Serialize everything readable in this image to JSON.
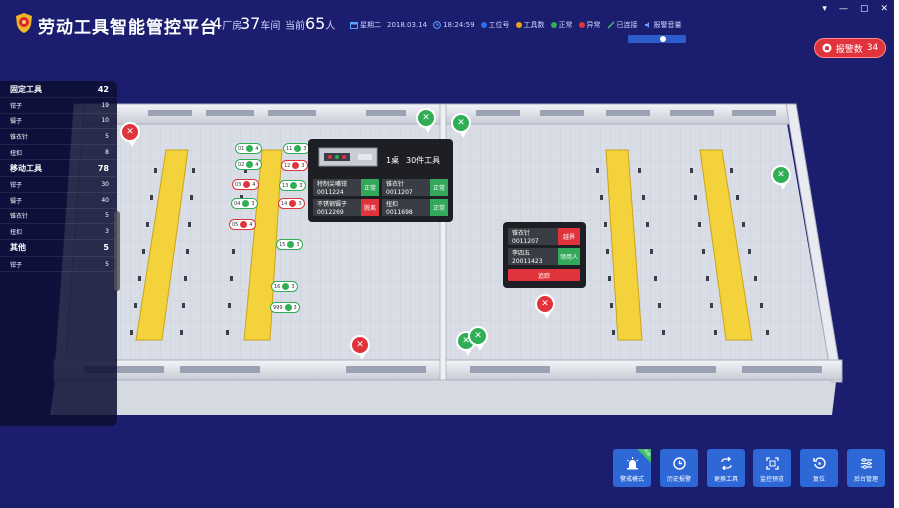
{
  "header": {
    "title": "劳动工具智能管控平台",
    "factory_num": "4",
    "factory_unit": "厂房",
    "workshop_num": "37",
    "workshop_unit": "车间",
    "current_prefix": "当前",
    "current_num": "65",
    "current_unit": "人",
    "weekday": "星期二",
    "date": "2018.03.14",
    "time": "18:24:59",
    "legend": [
      {
        "label": "工位号",
        "color": "#2f6cf0"
      },
      {
        "label": "工具数",
        "color": "#f0a21e"
      },
      {
        "label": "正常",
        "color": "#2fae55"
      },
      {
        "label": "异常",
        "color": "#e0333b"
      }
    ],
    "connected": "已连接",
    "volume_label": "报警音量",
    "volume_level": 0.62,
    "alarm_label": "报警数",
    "alarm_count": "34"
  },
  "left_panel": {
    "groups": [
      {
        "name": "固定工具",
        "count": "42",
        "items": [
          {
            "name": "钳子",
            "count": "19"
          },
          {
            "name": "镊子",
            "count": "10"
          },
          {
            "name": "锥衣针",
            "count": "5"
          },
          {
            "name": "扭扣",
            "count": "8"
          }
        ]
      },
      {
        "name": "移动工具",
        "count": "78",
        "items": [
          {
            "name": "钳子",
            "count": "30"
          },
          {
            "name": "镊子",
            "count": "40"
          },
          {
            "name": "锥衣针",
            "count": "5"
          },
          {
            "name": "扭扣",
            "count": "3"
          }
        ]
      },
      {
        "name": "其他",
        "count": "5",
        "items": [
          {
            "name": "钳子",
            "count": "5"
          }
        ]
      }
    ]
  },
  "popup_station": {
    "desk": "1桌",
    "tools": "30件工具",
    "rows": [
      {
        "name": "特制尖嘴钳",
        "code": "0011224",
        "status": "正常",
        "state": "ok"
      },
      {
        "name": "锥衣针",
        "code": "0011207",
        "status": "正常",
        "state": "ok"
      },
      {
        "name": "不锈钢镊子",
        "code": "0012269",
        "status": "脱离",
        "state": "bad"
      },
      {
        "name": "扭扣",
        "code": "0011698",
        "status": "正常",
        "state": "ok"
      }
    ]
  },
  "popup_alert": {
    "rows": [
      {
        "name": "锥衣针",
        "code": "0011207",
        "status": "越界",
        "state": "bad"
      },
      {
        "name": "李四五",
        "code": "20011423",
        "status": "领用人",
        "state": "ok"
      }
    ],
    "action": "追踪"
  },
  "badges": [
    {
      "label": "01",
      "n": "4",
      "state": "ok"
    },
    {
      "label": "02",
      "n": "4",
      "state": "ok"
    },
    {
      "label": "03",
      "n": "4",
      "state": "bad"
    },
    {
      "label": "04",
      "n": "3",
      "state": "ok"
    },
    {
      "label": "05",
      "n": "4",
      "state": "bad"
    },
    {
      "label": "11",
      "n": "3",
      "state": "ok"
    },
    {
      "label": "12",
      "n": "3",
      "state": "bad"
    },
    {
      "label": "13",
      "n": "3",
      "state": "ok"
    },
    {
      "label": "14",
      "n": "3",
      "state": "bad"
    },
    {
      "label": "15",
      "n": "3",
      "state": "ok"
    },
    {
      "label": "16",
      "n": "3",
      "state": "ok"
    },
    {
      "label": "999",
      "n": "3",
      "state": "ok"
    }
  ],
  "bottom_buttons": [
    {
      "label": "警戒模式",
      "icon": "siren-icon",
      "corner": "开启"
    },
    {
      "label": "历史报警",
      "icon": "clock-icon"
    },
    {
      "label": "更换工具",
      "icon": "swap-icon"
    },
    {
      "label": "监控预览",
      "icon": "monitor-icon"
    },
    {
      "label": "复位",
      "icon": "reset-icon"
    },
    {
      "label": "后台管理",
      "icon": "settings-sliders-icon"
    }
  ],
  "window": {
    "minimize": "—",
    "restore": "▢",
    "close": "✕",
    "menu": "▾"
  }
}
